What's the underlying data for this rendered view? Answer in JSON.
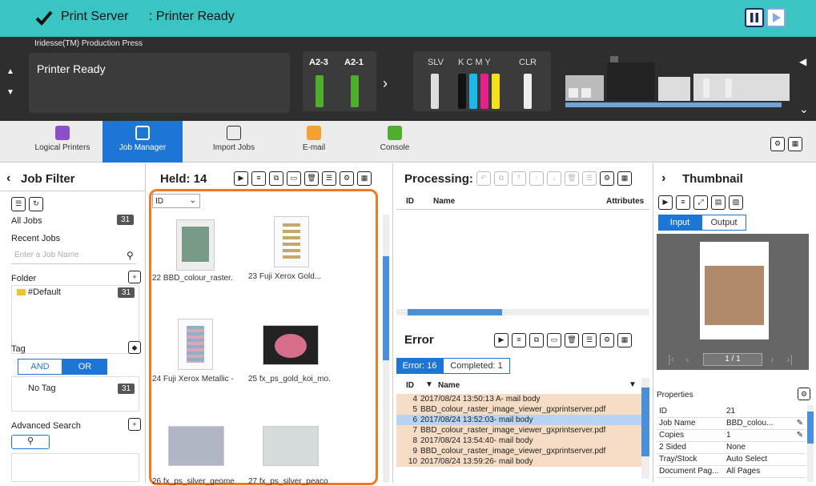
{
  "header": {
    "app_title": "Print Server",
    "status": ": Printer Ready"
  },
  "status_panel": {
    "model": "Iridesse(TM) Production Press",
    "message": "Printer Ready",
    "trays": [
      {
        "label": "A2-3",
        "color": "#4fae2e"
      },
      {
        "label": "A2-1",
        "color": "#4fae2e"
      }
    ],
    "toners": {
      "slv_label": "SLV",
      "kcmy_label": "K C M Y",
      "clr_label": "CLR"
    }
  },
  "tabs": [
    {
      "label": "Logical Printers",
      "color": "#8a4fc9"
    },
    {
      "label": "Job Manager",
      "color": "#1d76d6"
    },
    {
      "label": "Import Jobs",
      "color": "#333"
    },
    {
      "label": "E-mail",
      "color": "#f2a22e"
    },
    {
      "label": "Console",
      "color": "#4fae2e"
    }
  ],
  "job_filter": {
    "title": "Job Filter",
    "all_jobs": "All Jobs",
    "all_jobs_count": "31",
    "recent_jobs": "Recent Jobs",
    "search_placeholder": "Enter a Job Name",
    "folder": "Folder",
    "default_folder": "#Default",
    "default_count": "31",
    "tag": "Tag",
    "and": "AND",
    "or": "OR",
    "no_tag": "No Tag",
    "no_tag_count": "31",
    "advanced_search": "Advanced Search"
  },
  "held": {
    "title": "Held: 14",
    "sort": "ID",
    "thumbs": [
      {
        "caption": "22  BBD_colour_raster."
      },
      {
        "caption": "23  Fuji Xerox Gold..."
      },
      {
        "caption": "24  Fuji Xerox Metallic -"
      },
      {
        "caption": "25  fx_ps_gold_koi_mo."
      },
      {
        "caption": "26  fx_ps_silver_geome"
      },
      {
        "caption": "27  fx_ps_silver_peaco"
      }
    ]
  },
  "processing": {
    "title": "Processing:",
    "cols": {
      "id": "ID",
      "name": "Name",
      "attributes": "Attributes"
    }
  },
  "error": {
    "title": "Error",
    "tab_error": "Error: 16",
    "tab_completed": "Completed: 1",
    "cols": {
      "id": "ID",
      "name": "Name"
    },
    "rows": [
      {
        "id": "4",
        "name": "2017/08/24 13:50:13 A- mail body"
      },
      {
        "id": "5",
        "name": "BBD_colour_raster_image_viewer_gxprintserver.pdf"
      },
      {
        "id": "6",
        "name": "2017/08/24 13:52:03- mail body"
      },
      {
        "id": "7",
        "name": "BBD_colour_raster_image_viewer_gxprintserver.pdf"
      },
      {
        "id": "8",
        "name": "2017/08/24 13:54:40- mail body"
      },
      {
        "id": "9",
        "name": "BBD_colour_raster_image_viewer_gxprintserver.pdf"
      },
      {
        "id": "10",
        "name": "2017/08/24 13:59:26- mail body"
      }
    ]
  },
  "thumbnail": {
    "title": "Thumbnail",
    "input": "Input",
    "output": "Output",
    "page": "1 / 1",
    "properties_label": "Properties",
    "props": [
      {
        "k": "ID",
        "v": "21"
      },
      {
        "k": "Job Name",
        "v": "BBD_colou..."
      },
      {
        "k": "Copies",
        "v": "1"
      },
      {
        "k": "2 Sided",
        "v": "None"
      },
      {
        "k": "Tray/Stock",
        "v": "Auto Select"
      },
      {
        "k": "Document Pag...",
        "v": "All Pages"
      }
    ]
  }
}
